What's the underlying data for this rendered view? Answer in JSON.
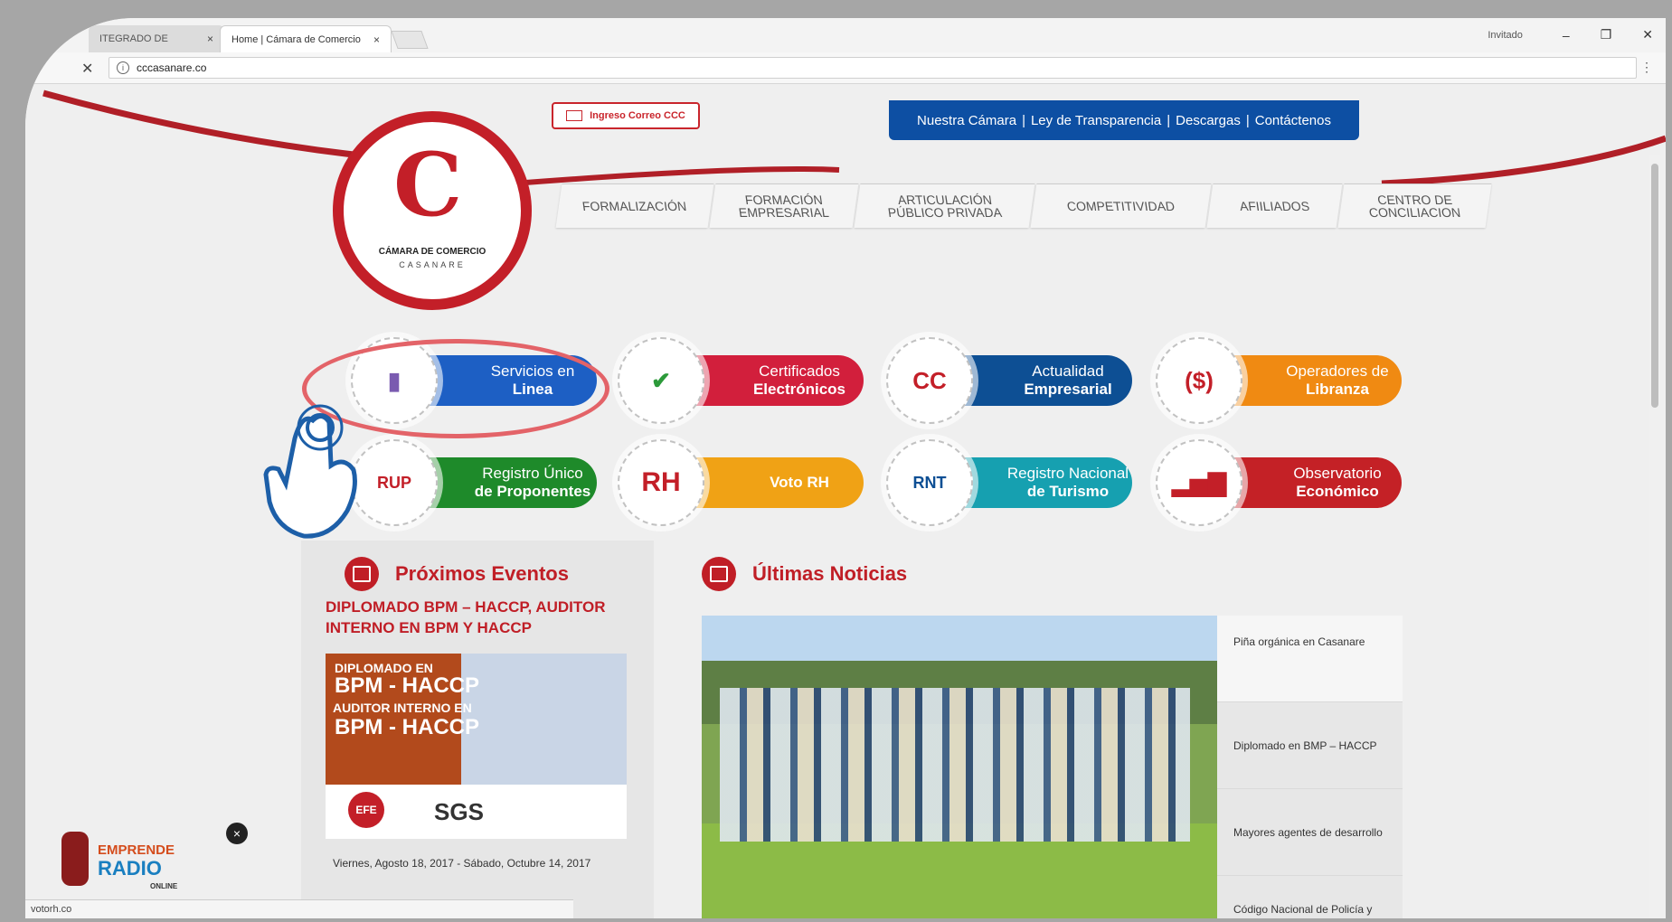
{
  "browser": {
    "tabs": [
      {
        "label": "ITEGRADO DE"
      },
      {
        "label": "Home | Cámara de Comercio"
      }
    ],
    "close_glyph": "×",
    "profile": "Invitado",
    "controls": {
      "minimize": "–",
      "restore": "❐",
      "close": "✕"
    },
    "stop_glyph": "✕",
    "url": "cccasanare.co",
    "status_text": "votorh.co"
  },
  "header": {
    "top_links": [
      "Nuestra Cámara",
      "Ley de Transparencia",
      "Descargas",
      "Contáctenos"
    ],
    "mail_button": "Ingreso Correo CCC",
    "logo_name": "CÁMARA DE COMERCIO",
    "logo_sub": "CASANARE",
    "nav": [
      {
        "line1": "FORMALIZACIÓN",
        "line2": ""
      },
      {
        "line1": "FORMACIÓN",
        "line2": "EMPRESARIAL"
      },
      {
        "line1": "ARTICULACIÓN",
        "line2": "PÚBLICO PRIVADA"
      },
      {
        "line1": "COMPETITIVIDAD",
        "line2": ""
      },
      {
        "line1": "AFIILIADOS",
        "line2": ""
      },
      {
        "line1": "CENTRO DE",
        "line2": "CONCILIACION"
      }
    ]
  },
  "services": [
    {
      "line1": "Servicios en",
      "line2": "Linea",
      "color": "#1d5fc4",
      "icon": "phone-apps-icon"
    },
    {
      "line1": "Certificados",
      "line2": "Electrónicos",
      "color": "#d21f3c",
      "icon": "printer-check-icon"
    },
    {
      "line1": "Actualidad",
      "line2": "Empresarial",
      "color": "#0d4f94",
      "icon": "microphone-icon"
    },
    {
      "line1": "Operadores de",
      "line2": "Libranza",
      "color": "#f08a12",
      "icon": "money-exchange-icon"
    },
    {
      "line1": "Registro Único",
      "line2": "de Proponentes",
      "color": "#1e8a2a",
      "icon": "rup-icon"
    },
    {
      "line1": "",
      "line2": "Voto RH",
      "color": "#f0a215",
      "icon": "voto-rh-icon"
    },
    {
      "line1": "Registro Nacional",
      "line2": "de Turismo",
      "color": "#16a0b0",
      "icon": "rnt-icon"
    },
    {
      "line1": "Observatorio",
      "line2": "Económico",
      "color": "#c42126",
      "icon": "bar-chart-icon"
    }
  ],
  "icon_glyphs": {
    "phone": "▮",
    "printer": "✔",
    "microphone": "CC",
    "money": "($)",
    "rup": "RUP",
    "rh": "RH",
    "rnt": "RNT",
    "bars": "▂▅▇"
  },
  "events": {
    "heading": "Próximos Eventos",
    "title": "DIPLOMADO BPM – HACCP, AUDITOR INTERNO EN BPM Y HACCP",
    "image": {
      "t1": "DIPLOMADO EN",
      "t2": "BPM - HACCP",
      "t3": "AUDITOR INTERNO EN",
      "t4": "BPM - HACCP",
      "logo1": "EFE",
      "logo2": "SGS"
    },
    "date": "Viernes, Agosto 18, 2017 - Sábado, Octubre 14, 2017"
  },
  "news": {
    "heading": "Últimas Noticias",
    "items": [
      "Piña orgánica en Casanare",
      "Diplomado en BMP – HACCP",
      "Mayores agentes de desarrollo",
      "Código Nacional de Policía y Convivencia"
    ]
  },
  "radio": {
    "line1": "EMPRENDE",
    "line2": "RADIO",
    "line3": "ONLINE"
  },
  "close_bubble": "×",
  "colors": {
    "brand_red": "#c31f28",
    "brand_blue": "#0d4fa3",
    "highlight": "#e36368"
  }
}
